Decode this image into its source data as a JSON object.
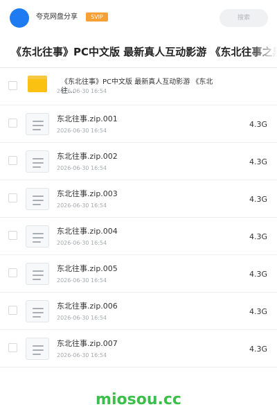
{
  "header": {
    "user_name": "夸克网盘分享",
    "badge": "SVIP",
    "search_label": "搜索"
  },
  "share": {
    "title": "《东北往事》PC中文版 最新真人互动影游 《东北往事之黑"
  },
  "folder": {
    "name": "《东北往事》PC中文版 最新真人互动影游 《东北往…",
    "date": "2026-06-30 16:54"
  },
  "files": [
    {
      "name": "东北往事.zip.001",
      "date": "2026-06-30 16:54",
      "size": "4.3G"
    },
    {
      "name": "东北往事.zip.002",
      "date": "2026-06-30 16:54",
      "size": "4.3G"
    },
    {
      "name": "东北往事.zip.003",
      "date": "2026-06-30 16:54",
      "size": "4.3G"
    },
    {
      "name": "东北往事.zip.004",
      "date": "2026-06-30 16:54",
      "size": "4.3G"
    },
    {
      "name": "东北往事.zip.005",
      "date": "2026-06-30 16:54",
      "size": "4.3G"
    },
    {
      "name": "东北往事.zip.006",
      "date": "2026-06-30 16:54",
      "size": "4.3G"
    },
    {
      "name": "东北往事.zip.007",
      "date": "2026-06-30 16:54",
      "size": "4.3G"
    }
  ],
  "watermark": "miosou.cc",
  "colors": {
    "avatar": "#1e7bf2",
    "badge": "#f7a035",
    "folder": "#fac012",
    "watermark": "#3bbf4a"
  },
  "icons": {
    "folder": "folder-icon",
    "file": "document-icon"
  }
}
